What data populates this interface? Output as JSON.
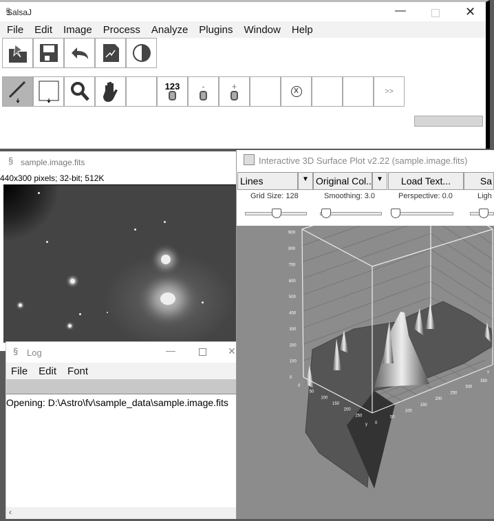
{
  "main": {
    "title": "SalsaJ",
    "menu": [
      "File",
      "Edit",
      "Image",
      "Process",
      "Analyze",
      "Plugins",
      "Window",
      "Help"
    ],
    "toolbar1": [
      "open-icon",
      "save-icon",
      "undo-icon",
      "plot-icon",
      "contrast-icon"
    ],
    "toolbar2": [
      {
        "icon": "line-tool-icon"
      },
      {
        "icon": "rectangle-tool-icon"
      },
      {
        "icon": "magnifier-icon"
      },
      {
        "icon": "hand-icon"
      },
      {
        "icon": ""
      },
      {
        "icon": "photometry-icon",
        "label": "123"
      },
      {
        "icon": "photometry-minus-icon",
        "label": "-"
      },
      {
        "icon": "photometry-plus-icon",
        "label": "+"
      },
      {
        "icon": ""
      },
      {
        "icon": "x-icon",
        "label": "X"
      },
      {
        "icon": ""
      },
      {
        "icon": ""
      },
      {
        "icon": "more-icon",
        "label": ">>"
      }
    ]
  },
  "image_window": {
    "title": "sample.image.fits",
    "info": "440x300 pixels; 32-bit; 512K"
  },
  "log_window": {
    "title": "Log",
    "menu": [
      "File",
      "Edit",
      "Font"
    ],
    "text": "Opening: D:\\Astro\\fv\\sample_data\\sample.image.fits"
  },
  "plot_window": {
    "title": "Interactive 3D Surface Plot v2.22  (sample.image.fits)",
    "display_mode": "Lines",
    "color_mode": "Original Col...",
    "load_button": "Load Text...",
    "save_button": "Sa",
    "sliders": [
      {
        "label": "Grid Size: 128",
        "value": 128
      },
      {
        "label": "Smoothing: 3.0",
        "value": 3.0
      },
      {
        "label": "Perspective: 0.0",
        "value": 0.0
      },
      {
        "label": "Ligh"
      }
    ],
    "z_ticks": [
      "0",
      "100",
      "200",
      "300",
      "400",
      "500",
      "600",
      "700",
      "800",
      "900"
    ],
    "y_ticks": [
      "0",
      "50",
      "100",
      "150",
      "200",
      "250"
    ],
    "y_label": "y",
    "x_ticks": [
      "0",
      "50",
      "100",
      "150",
      "200",
      "250",
      "300",
      "350"
    ],
    "x_label": "x"
  }
}
